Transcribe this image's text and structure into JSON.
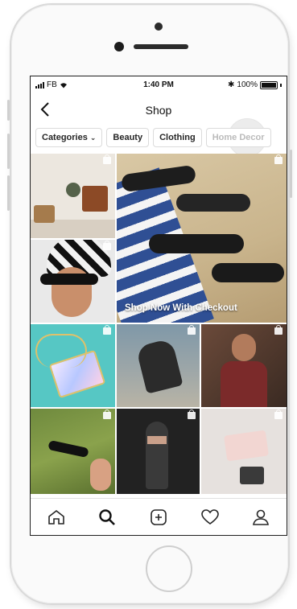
{
  "status_bar": {
    "carrier": "FB",
    "time": "1:40 PM",
    "battery": "100%"
  },
  "header": {
    "title": "Shop",
    "back_icon": "chevron-left-icon"
  },
  "filters": [
    {
      "label": "Categories",
      "has_dropdown": true
    },
    {
      "label": "Beauty"
    },
    {
      "label": "Clothing"
    },
    {
      "label": "Home Decor"
    }
  ],
  "feature_post": {
    "caption": "Shop Now With Checkout"
  },
  "tab_bar": {
    "icons": [
      "home-icon",
      "search-icon",
      "new-post-icon",
      "activity-heart-icon",
      "profile-icon"
    ],
    "active": "search-icon"
  },
  "colors": {
    "text": "#262626",
    "chip_border": "#dbdbdb",
    "faded_chip_text": "#bbbbbb"
  }
}
